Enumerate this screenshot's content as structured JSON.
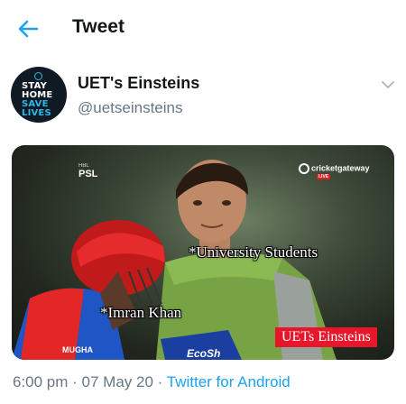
{
  "header": {
    "title": "Tweet",
    "back_icon": "arrow-left-icon",
    "accent": "#1da1f2"
  },
  "author": {
    "display_name": "UET's Einsteins",
    "handle": "@uetseinsteins",
    "avatar_lines": [
      "STAY",
      "HOME",
      "SAVE",
      "LIVES"
    ],
    "menu_icon": "chevron-down-icon"
  },
  "media": {
    "caption_top": "*University Students",
    "caption_bottom": "*Imran Khan",
    "watermark": "UETs Einsteins",
    "logo_left": "PSL",
    "logo_left_sub": "HBL",
    "logo_right": "cricketgateway",
    "logo_right_sub": "LIVE",
    "jersey_text": "MUGHA",
    "shirt_text": "EcoSh"
  },
  "meta": {
    "time": "6:00 pm",
    "separator": " · ",
    "date": "07 May 20",
    "app": "Twitter for Android"
  },
  "colors": {
    "text_primary": "#14171a",
    "text_secondary": "#657786",
    "link": "#1da1f2",
    "watermark_bg": "#e8162b"
  }
}
